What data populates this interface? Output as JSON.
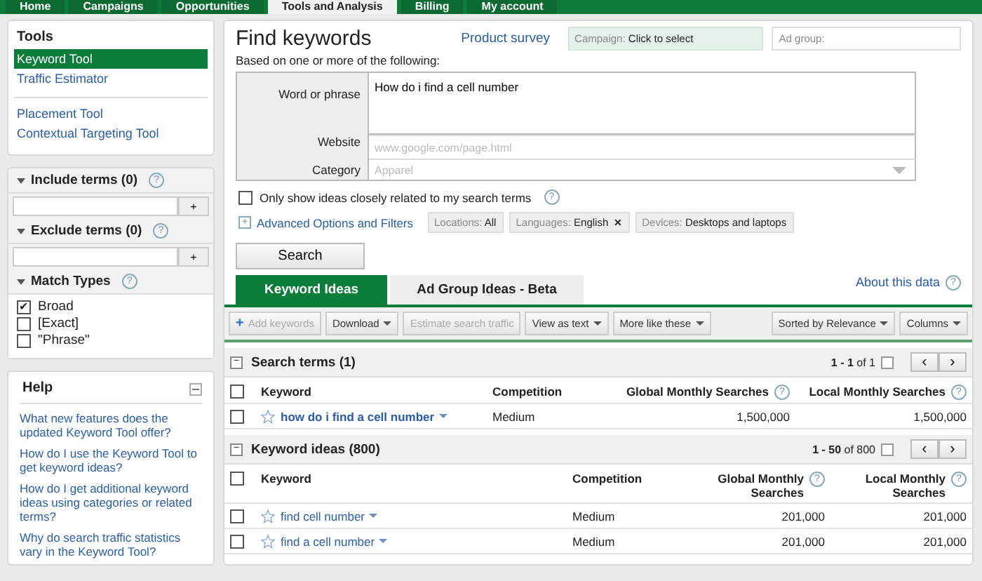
{
  "nav": [
    {
      "label": "Home",
      "selected": false
    },
    {
      "label": "Campaigns",
      "selected": false
    },
    {
      "label": "Opportunities",
      "selected": false
    },
    {
      "label": "Tools and Analysis",
      "selected": true
    },
    {
      "label": "Billing",
      "selected": false
    },
    {
      "label": "My account",
      "selected": false
    }
  ],
  "sidebar": {
    "tools_title": "Tools",
    "tools": [
      {
        "label": "Keyword Tool",
        "selected": true
      },
      {
        "label": "Traffic Estimator",
        "selected": false
      }
    ],
    "more_tools": [
      {
        "label": "Placement Tool",
        "selected": false
      },
      {
        "label": "Contextual Targeting Tool",
        "selected": false
      }
    ],
    "include_terms": {
      "title": "Include terms (0)",
      "add": "+"
    },
    "exclude_terms": {
      "title": "Exclude terms (0)",
      "add": "+"
    },
    "match_types": {
      "title": "Match Types",
      "options": [
        {
          "label": "Broad",
          "checked": true
        },
        {
          "label": "[Exact]",
          "checked": false
        },
        {
          "label": "\"Phrase\"",
          "checked": false
        }
      ]
    },
    "help": {
      "title": "Help",
      "links": [
        "What new features does the updated Keyword Tool offer?",
        "How do I use the Keyword Tool to get keyword ideas?",
        "How do I get additional keyword ideas using categories or related terms?",
        "Why do search traffic statistics vary in the Keyword Tool?"
      ]
    }
  },
  "main": {
    "title": "Find keywords",
    "survey_link": "Product survey",
    "campaign": {
      "label": "Campaign:",
      "value": "Click to select"
    },
    "ad_group": {
      "label": "Ad group:"
    },
    "subtitle": "Based on one or more of the following:",
    "form": {
      "word_label": "Word or phrase",
      "word_value": "How do i find a cell number",
      "website_label": "Website",
      "website_placeholder": "www.google.com/page.html",
      "category_label": "Category",
      "category_placeholder": "Apparel"
    },
    "closely_related": {
      "label": "Only show ideas closely related to my search terms",
      "checked": false
    },
    "advanced": {
      "expand": "+",
      "label": "Advanced Options and Filters"
    },
    "filters": [
      {
        "label": "Locations:",
        "value": "All",
        "removable": false
      },
      {
        "label": "Languages:",
        "value": "English",
        "removable": true
      },
      {
        "label": "Devices:",
        "value": "Desktops and laptops",
        "removable": false
      }
    ],
    "remove_mark": "✕",
    "help_mark": "?",
    "check_mark": "✔",
    "add_mark": "+",
    "prev_mark": "‹",
    "next_mark": "›",
    "search_button": "Search",
    "tabs": [
      {
        "label": "Keyword Ideas",
        "selected": true
      },
      {
        "label": "Ad Group Ideas - Beta",
        "selected": false
      }
    ],
    "about_link": "About this data",
    "toolbar": [
      {
        "label": "Add keywords",
        "kind": "add",
        "disabled": true
      },
      {
        "label": "Download",
        "kind": "menu",
        "disabled": false
      },
      {
        "label": "Estimate search traffic",
        "kind": "plain",
        "disabled": true
      },
      {
        "label": "View as text",
        "kind": "menu",
        "disabled": false
      },
      {
        "label": "More like these",
        "kind": "menu",
        "disabled": false
      },
      {
        "label": "Sorted by Relevance",
        "kind": "menu",
        "disabled": false
      },
      {
        "label": "Columns",
        "kind": "menu",
        "disabled": false
      }
    ],
    "sections": [
      {
        "kind": "search_terms",
        "title": "Search terms (1)",
        "paging": "1 - 1",
        "of": "of 1",
        "collapse": "−",
        "all_checked": false,
        "columns": [
          {
            "label": "Keyword",
            "help": false
          },
          {
            "label": "Competition",
            "help": false
          },
          {
            "label": "Global Monthly Searches",
            "help": true
          },
          {
            "label": "Local Monthly Searches",
            "help": true
          }
        ],
        "rows": [
          {
            "keyword": "how do i find a cell number",
            "competition": "Medium",
            "global": "1,500,000",
            "local": "1,500,000",
            "checked": false,
            "starred": false
          }
        ]
      },
      {
        "kind": "ideas",
        "title": "Keyword ideas (800)",
        "paging": "1 - 50",
        "of": "of 800",
        "collapse": "−",
        "all_checked": false,
        "columns": [
          {
            "label": "Keyword",
            "help": false
          },
          {
            "label": "Competition",
            "help": false
          },
          {
            "label": "Global Monthly Searches",
            "help": true
          },
          {
            "label": "Local Monthly Searches",
            "help": true
          }
        ],
        "rows": [
          {
            "keyword": "find cell number",
            "competition": "Medium",
            "global": "201,000",
            "local": "201,000",
            "checked": false,
            "starred": false
          },
          {
            "keyword": "find a cell number",
            "competition": "Medium",
            "global": "201,000",
            "local": "201,000",
            "checked": false,
            "starred": false
          }
        ]
      }
    ]
  }
}
